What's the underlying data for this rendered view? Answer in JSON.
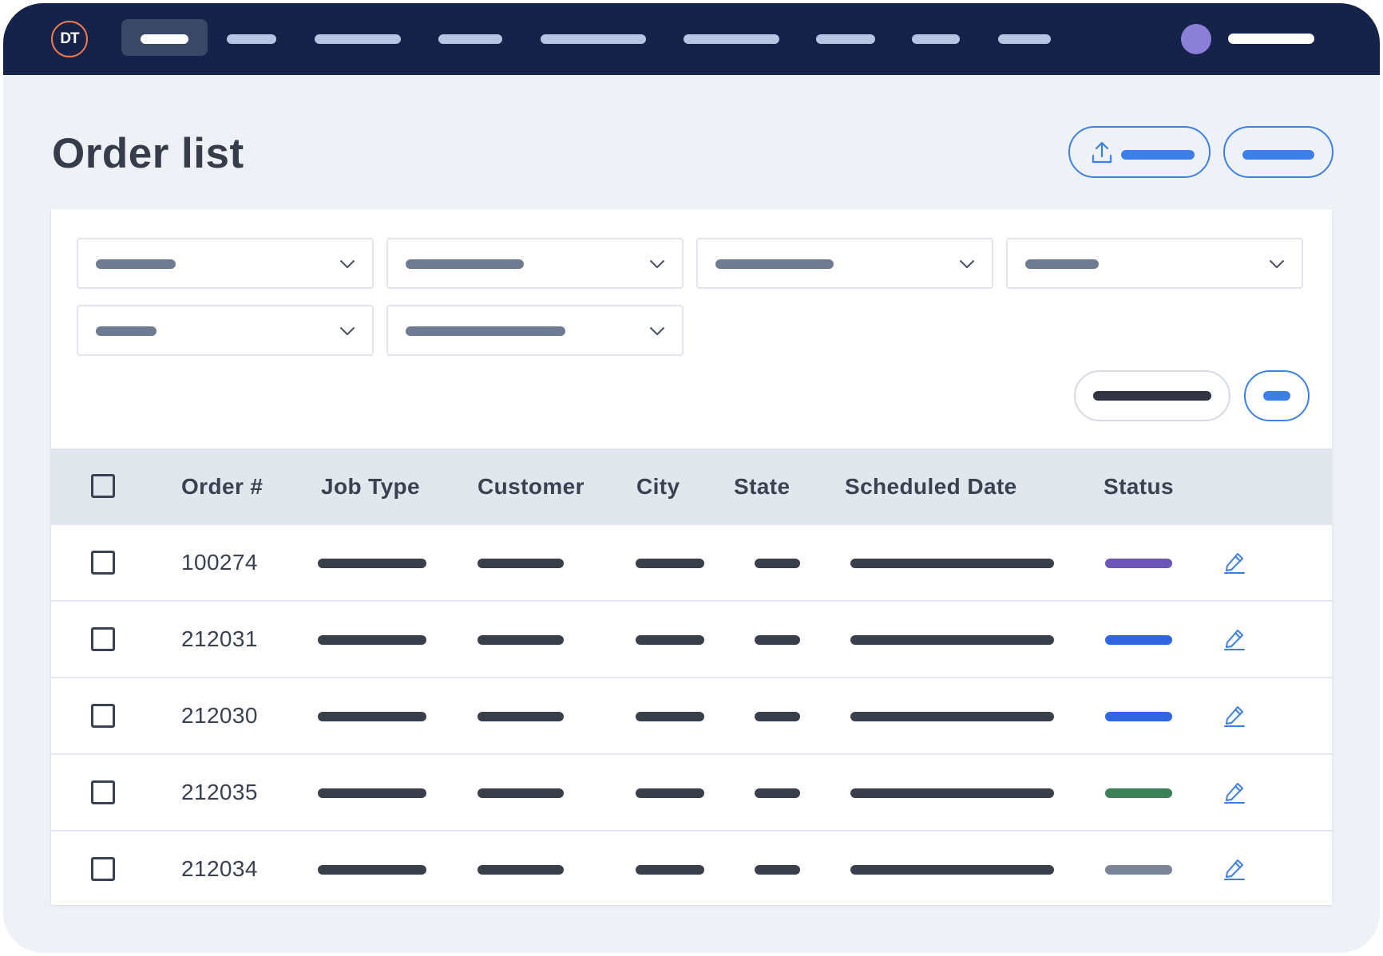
{
  "app": {
    "logo_text": "DT",
    "nav_items": [
      {
        "name": "nav-item-1",
        "active": true
      },
      {
        "name": "nav-item-2",
        "active": false
      },
      {
        "name": "nav-item-3",
        "active": false
      },
      {
        "name": "nav-item-4",
        "active": false
      },
      {
        "name": "nav-item-5",
        "active": false
      },
      {
        "name": "nav-item-6",
        "active": false
      },
      {
        "name": "nav-item-7",
        "active": false
      },
      {
        "name": "nav-item-8",
        "active": false
      },
      {
        "name": "nav-item-9",
        "active": false
      }
    ],
    "avatar_color": "#8b7fd8"
  },
  "page": {
    "title": "Order list",
    "actions": [
      {
        "name": "upload-button",
        "icon": "upload-icon"
      },
      {
        "name": "secondary-action-button"
      }
    ]
  },
  "filters": {
    "dropdowns": [
      {
        "name": "filter-dropdown-1",
        "icon": "chevron-down-icon"
      },
      {
        "name": "filter-dropdown-2",
        "icon": "chevron-down-icon"
      },
      {
        "name": "filter-dropdown-3",
        "icon": "chevron-down-icon"
      },
      {
        "name": "filter-dropdown-4",
        "icon": "chevron-down-icon"
      },
      {
        "name": "filter-dropdown-5",
        "icon": "chevron-down-icon"
      },
      {
        "name": "filter-dropdown-6",
        "icon": "chevron-down-icon"
      }
    ],
    "buttons": [
      {
        "name": "clear-filters-button"
      },
      {
        "name": "apply-filters-button"
      }
    ]
  },
  "table": {
    "columns": [
      "Order #",
      "Job Type",
      "Customer",
      "City",
      "State",
      "Scheduled Date",
      "Status"
    ],
    "rows": [
      {
        "order": "100274",
        "status_color": "#6b56b8"
      },
      {
        "order": "212031",
        "status_color": "#3166e0"
      },
      {
        "order": "212030",
        "status_color": "#3166e0"
      },
      {
        "order": "212035",
        "status_color": "#3a8158"
      },
      {
        "order": "212034",
        "status_color": "#7a8597"
      }
    ],
    "edit_icon": "edit-pencil-icon"
  },
  "colors": {
    "nav_bg": "#15224a",
    "accent": "#3d7fe8",
    "page_bg": "#eef2f6",
    "text_dark": "#3a4150"
  }
}
